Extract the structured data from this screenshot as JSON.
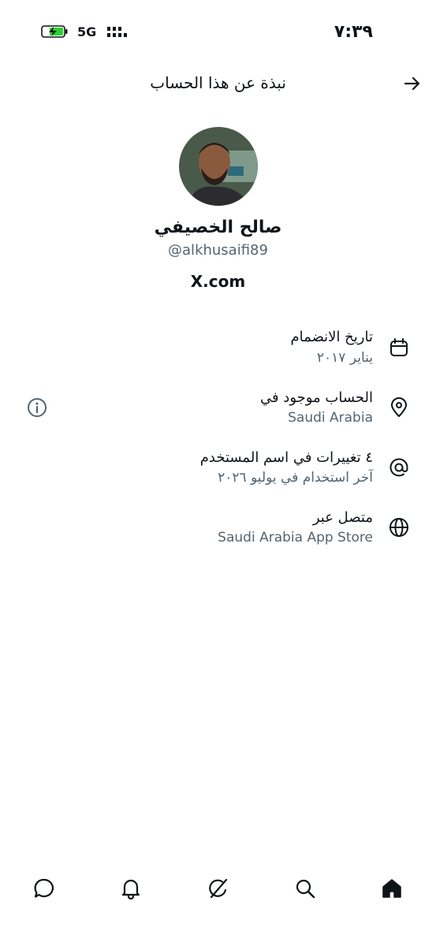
{
  "status_bar": {
    "time": "٧:٣٩",
    "network": "5G",
    "icons": [
      "battery-charging-icon",
      "signal-icon"
    ]
  },
  "header": {
    "title": "نبذة عن هذا الحساب",
    "back_icon": "arrow-right-icon"
  },
  "profile": {
    "name": "صالح الخصيفي",
    "handle": "@alkhusaifi89",
    "domain": "X.com"
  },
  "rows": [
    {
      "icon": "calendar-icon",
      "title": "تاريخ الانضمام",
      "value": "يناير ٢٠١٧"
    },
    {
      "icon": "location-pin-icon",
      "title": "الحساب موجود في",
      "value": "Saudi Arabia",
      "extra_icon": "info-icon"
    },
    {
      "icon": "at-sign-icon",
      "title": "٤ تغييرات في اسم المستخدم",
      "value": "آخر استخدام في يوليو ٢٠٢٦"
    },
    {
      "icon": "globe-icon",
      "title": "متصل عبر",
      "value": "Saudi Arabia App Store"
    }
  ],
  "bottom_nav": [
    "messages-icon",
    "notifications-icon",
    "grok-icon",
    "search-icon",
    "home-icon"
  ],
  "colors": {
    "text_primary": "#0f1419",
    "text_secondary": "#536471",
    "battery_green": "#2bd12b"
  }
}
